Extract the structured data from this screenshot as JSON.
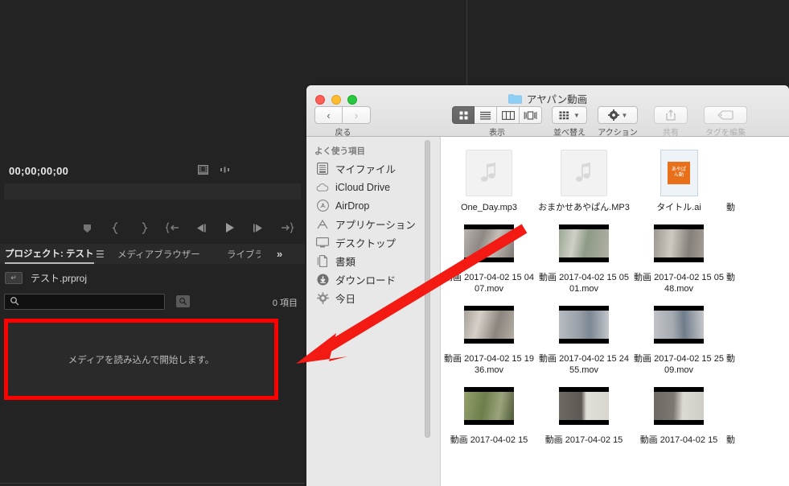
{
  "premiere": {
    "monitor": {
      "timecode": "00;00;00;00",
      "icon_export_frame": "export-frame-icon",
      "icon_markers": "markers-icon"
    },
    "transport": [
      {
        "name": "add-marker-button",
        "glyph": "marker"
      },
      {
        "name": "mark-in-button",
        "glyph": "{"
      },
      {
        "name": "mark-out-button",
        "glyph": "}"
      },
      {
        "name": "go-to-in-button",
        "glyph": "{←"
      },
      {
        "name": "step-back-button",
        "glyph": "◀|"
      },
      {
        "name": "play-button",
        "glyph": "▶"
      },
      {
        "name": "step-forward-button",
        "glyph": "|▶"
      },
      {
        "name": "go-to-out-button",
        "glyph": "→}"
      }
    ],
    "panel": {
      "tabs": [
        {
          "label": "プロジェクト: テスト",
          "active": true
        },
        {
          "label": "メディアブラウザー",
          "active": false
        },
        {
          "label": "ライブラ",
          "active": false
        }
      ],
      "tab_menu_icon": "hamburger-icon",
      "tab_overflow_label": "»",
      "project_file": "テスト.prproj",
      "search_value": "",
      "search_placeholder": "",
      "search_icon": "search-icon",
      "filter_icon": "filter-icon",
      "item_count": "0 項目",
      "dropzone_text": "メディアを読み込んで開始します。",
      "dropzone_border_color": "#ff0000"
    }
  },
  "finder": {
    "window_title": "アヤパン動画",
    "folder_icon": "folder-icon",
    "traffic_lights": [
      {
        "name": "close-button",
        "color": "#ff5f57"
      },
      {
        "name": "minimize-button",
        "color": "#ffbd2e"
      },
      {
        "name": "maximize-button",
        "color": "#28c940"
      }
    ],
    "toolbar": {
      "back_glyph": "‹",
      "forward_glyph": "›",
      "nav_label": "戻る",
      "view_label": "表示",
      "view_modes": [
        {
          "name": "view-icon-grid",
          "active": true
        },
        {
          "name": "view-list",
          "active": false
        },
        {
          "name": "view-columns",
          "active": false
        },
        {
          "name": "view-coverflow",
          "active": false
        }
      ],
      "sort_label": "並べ替え",
      "action_label": "アクション",
      "share_label": "共有",
      "tag_label": "タグを編集"
    },
    "sidebar": {
      "header": "よく使う項目",
      "items": [
        {
          "label": "マイファイル",
          "icon": "myfiles-icon"
        },
        {
          "label": "iCloud Drive",
          "icon": "icloud-icon"
        },
        {
          "label": "AirDrop",
          "icon": "airdrop-icon"
        },
        {
          "label": "アプリケーション",
          "icon": "applications-icon"
        },
        {
          "label": "デスクトップ",
          "icon": "desktop-icon"
        },
        {
          "label": "書類",
          "icon": "documents-icon"
        },
        {
          "label": "ダウンロード",
          "icon": "downloads-icon"
        },
        {
          "label": "今日",
          "icon": "today-icon"
        }
      ]
    },
    "files": [
      [
        {
          "name": "One_Day.mp3",
          "kind": "audio"
        },
        {
          "name": "おまかせあやぱん.MP3",
          "kind": "audio"
        },
        {
          "name": "タイトル.ai",
          "kind": "ai",
          "ai_text_1": "あやぱ",
          "ai_text_2": "ん動"
        },
        {
          "name": "動",
          "kind": "video",
          "clipped": true
        }
      ],
      [
        {
          "name": "動画 2017-04-02 15 04 07.mov",
          "kind": "video",
          "tone": "#9e9a96"
        },
        {
          "name": "動画 2017-04-02 15 05 01.mov",
          "kind": "video",
          "tone": "#8f9a8a"
        },
        {
          "name": "動画 2017-04-02 15 05 48.mov",
          "kind": "video",
          "tone": "#8c8a80"
        },
        {
          "name": "動",
          "kind": "video",
          "clipped": true
        }
      ],
      [
        {
          "name": "動画 2017-04-02 15 19 36.mov",
          "kind": "video",
          "tone": "#a09a94"
        },
        {
          "name": "動画 2017-04-02 15 24 55.mov",
          "kind": "video",
          "tone": "#9ba0a6"
        },
        {
          "name": "動画 2017-04-02 15 25 09.mov",
          "kind": "video",
          "tone": "#a3a6aa"
        },
        {
          "name": "動",
          "kind": "video",
          "clipped": true
        }
      ],
      [
        {
          "name": "動画 2017-04-02 15",
          "kind": "video",
          "tone": "#7d8a63"
        },
        {
          "name": "動画 2017-04-02 15",
          "kind": "video",
          "tone": "#8e8880"
        },
        {
          "name": "動画 2017-04-02 15",
          "kind": "video",
          "tone": "#8a8178"
        },
        {
          "name": "動",
          "kind": "video",
          "clipped": true
        }
      ]
    ]
  },
  "annotation": {
    "arrow_color": "#f41a14",
    "arrow_name": "red-pointer-arrow"
  }
}
